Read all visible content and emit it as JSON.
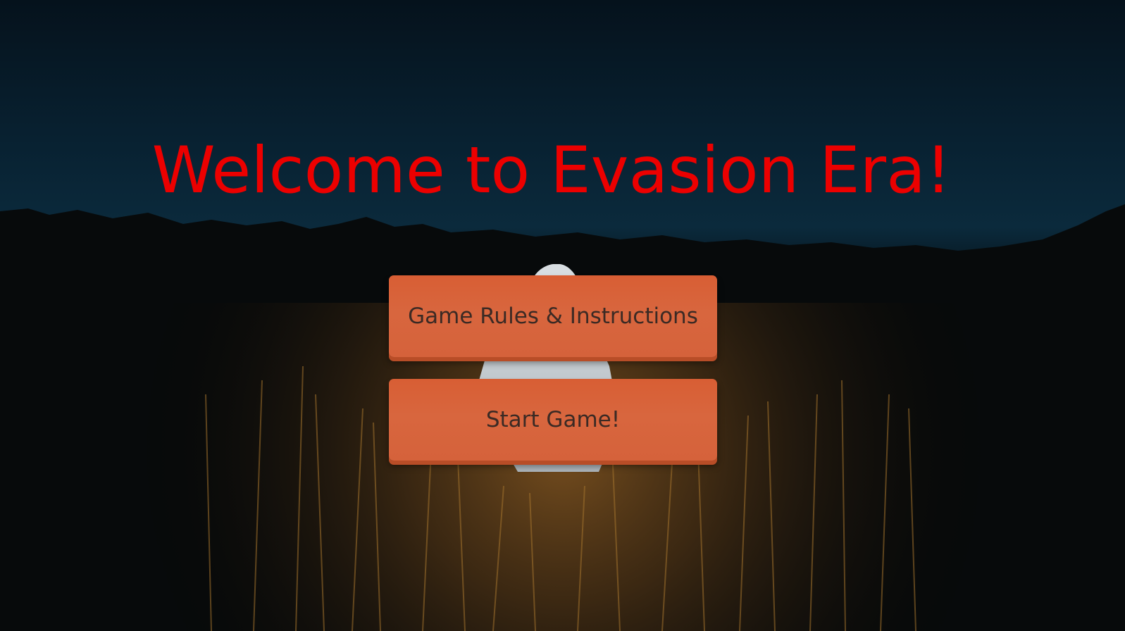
{
  "screen": {
    "title": "Welcome to Evasion Era!",
    "title_color": "#ec0000"
  },
  "menu": {
    "rules_label": "Game Rules & Instructions",
    "start_label": "Start Game!",
    "button_color": "#d8623a"
  },
  "background": {
    "scene": "ghost-figure-in-night-field"
  }
}
